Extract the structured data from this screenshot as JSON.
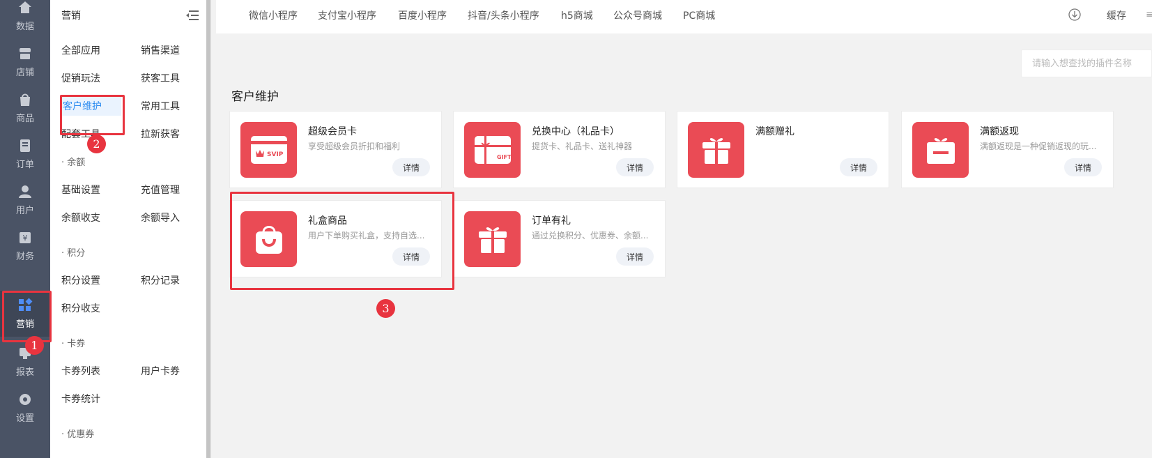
{
  "rail": {
    "items": [
      {
        "label": "数据",
        "icon": "home-icon"
      },
      {
        "label": "店铺",
        "icon": "store-icon"
      },
      {
        "label": "商品",
        "icon": "bag-icon"
      },
      {
        "label": "订单",
        "icon": "order-icon"
      },
      {
        "label": "用户",
        "icon": "user-icon"
      },
      {
        "label": "财务",
        "icon": "finance-icon"
      },
      {
        "label": "营销",
        "icon": "marketing-icon",
        "active": true
      },
      {
        "label": "报表",
        "icon": "report-icon"
      },
      {
        "label": "设置",
        "icon": "gear-icon"
      }
    ]
  },
  "subnav": {
    "title": "营销",
    "links": {
      "all_apps": "全部应用",
      "sales_channel": "销售渠道",
      "promo": "促销玩法",
      "acquire_tools": "获客工具",
      "customer_care": "客户维护",
      "common_tools": "常用工具",
      "support_tools": "配套工具",
      "new_customer": "拉新获客",
      "basic_settings": "基础设置",
      "recharge_mgmt": "充值管理",
      "balance_flow": "余额收支",
      "balance_import": "余额导入",
      "points_settings": "积分设置",
      "points_records": "积分记录",
      "points_flow": "积分收支",
      "card_list": "卡券列表",
      "user_cards": "用户卡券",
      "card_stats": "卡券统计"
    },
    "groups": {
      "balance": "· 余额",
      "points": "· 积分",
      "cards": "· 卡券",
      "coupons": "· 优惠券"
    }
  },
  "topbar": {
    "tabs": [
      "微信小程序",
      "支付宝小程序",
      "百度小程序",
      "抖音/头条小程序",
      "h5商城",
      "公众号商城",
      "PC商城"
    ],
    "cache": "缓存"
  },
  "search": {
    "placeholder": "请输入想查找的插件名称"
  },
  "section_title": "客户维护",
  "cards": [
    {
      "name": "超级会员卡",
      "desc": "享受超级会员折扣和福利",
      "detail": "详情",
      "icon": "svip-card-icon",
      "icon_text": "SVIP"
    },
    {
      "name": "兑换中心（礼品卡）",
      "desc": "提货卡、礼品卡、送礼神器",
      "detail": "详情",
      "icon": "gift-card-icon",
      "icon_text": "GIFT"
    },
    {
      "name": "满额赠礼",
      "desc": "",
      "detail": "详情",
      "icon": "gift-box-icon"
    },
    {
      "name": "满额返现",
      "desc": "满额返现是一种促销返现的玩...",
      "detail": "详情",
      "icon": "gift-box-icon"
    },
    {
      "name": "礼盒商品",
      "desc": "用户下单购买礼盒，支持自选...",
      "detail": "详情",
      "icon": "shopping-bag-icon"
    },
    {
      "name": "订单有礼",
      "desc": "通过兑换积分、优惠券、余额...",
      "detail": "详情",
      "icon": "gift-box-icon"
    }
  ],
  "annotations": {
    "step1": "1",
    "step2": "2",
    "step3": "3"
  },
  "colors": {
    "accent_red": "#ea4b55",
    "active_blue": "#2d8cf0",
    "rail_bg": "#4a5365",
    "marker_red": "#e8343f"
  }
}
